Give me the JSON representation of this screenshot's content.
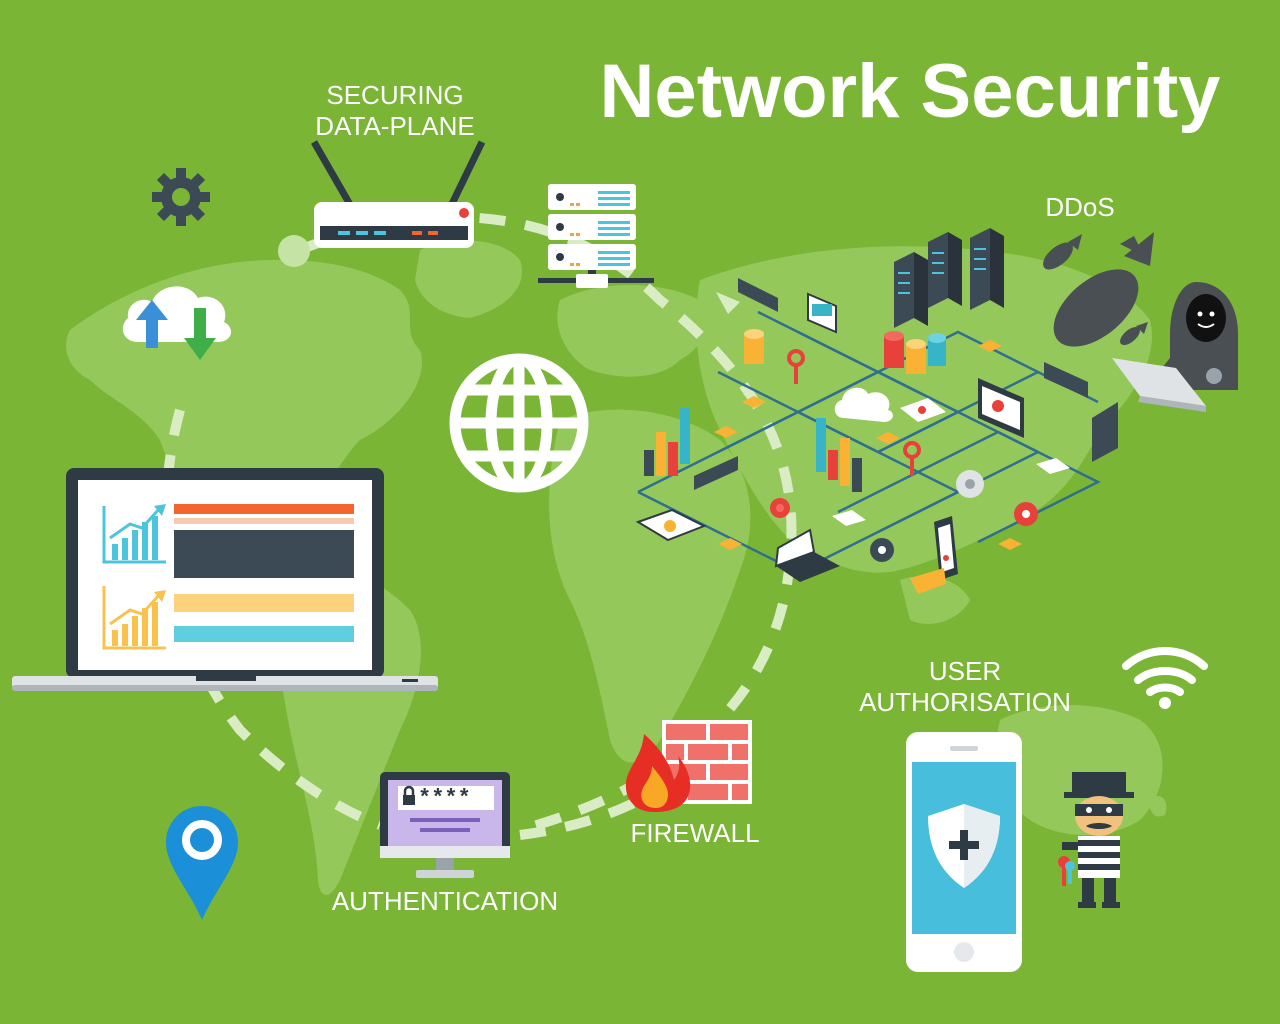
{
  "title": "Network Security",
  "labels": {
    "data_plane_line1": "SECURING",
    "data_plane_line2": "DATA-PLANE",
    "ddos": "DDoS",
    "user_auth_line1": "USER",
    "user_auth_line2": "AUTHORISATION",
    "firewall": "FIREWALL",
    "authentication": "AUTHENTICATION",
    "password_mask": "****"
  },
  "colors": {
    "background": "#7ab536",
    "map": "#95c85a",
    "dashed_path": "#d9ecc4",
    "accent_orange": "#f26430",
    "accent_blue": "#4cc4dd",
    "dark": "#3c4a55"
  },
  "icons": [
    "gear-icon",
    "cloud-sync-icon",
    "router-icon",
    "server-icon",
    "globe-icon",
    "laptop-icon",
    "location-pin-icon",
    "monitor-password-icon",
    "firewall-icon",
    "smartphone-shield-icon",
    "thief-icon",
    "hacker-icon",
    "bomb-icon",
    "wifi-icon",
    "isometric-network-icon"
  ]
}
